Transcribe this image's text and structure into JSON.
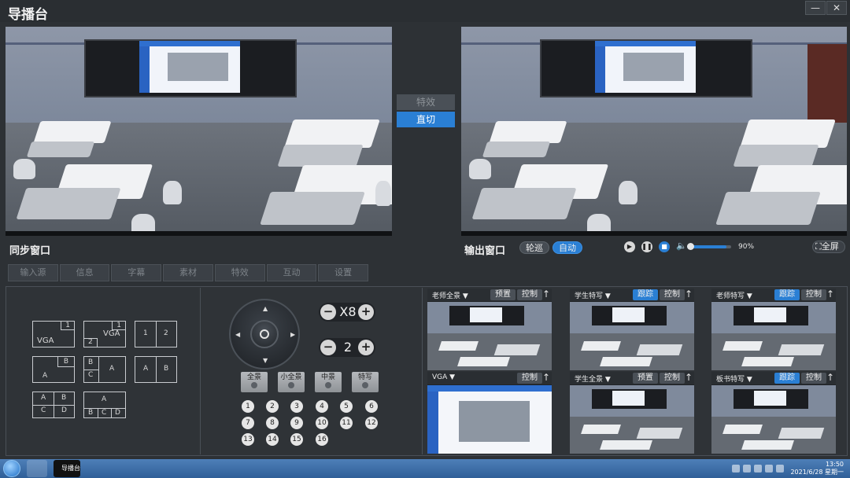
{
  "app": {
    "title": "导播台",
    "minimize": "—",
    "close": "✕"
  },
  "sync_window": {
    "label": "同步窗口"
  },
  "output_window": {
    "label": "输出窗口",
    "tour_label": "轮巡",
    "auto_label": "自动",
    "volume": "90%",
    "fullscreen_label": "全屏",
    "play_icon": "play-icon",
    "pause_icon": "pause-icon",
    "stop_icon": "stop-icon"
  },
  "transition": {
    "effects_label": "特效",
    "direct_cut_label": "直切"
  },
  "tabs": [
    "输入源",
    "信息",
    "字幕",
    "素材",
    "特效",
    "互动",
    "设置"
  ],
  "layouts": [
    {
      "labels": [
        "VGA",
        "1"
      ]
    },
    {
      "labels": [
        "VGA",
        "1",
        "2"
      ]
    },
    {
      "labels": [
        "1",
        "2"
      ]
    },
    {
      "labels": [
        "A",
        "B"
      ]
    },
    {
      "labels": [
        "B",
        "C",
        "A"
      ]
    },
    {
      "labels": [
        "A",
        "B"
      ]
    },
    {
      "labels": [
        "A",
        "B",
        "C",
        "D"
      ]
    },
    {
      "labels": [
        "A",
        "B",
        "C",
        "D"
      ]
    }
  ],
  "ptz": {
    "zoom_value": "X8",
    "speed_value": "2",
    "minus": "−",
    "plus": "+",
    "presets": [
      "全景",
      "小全景",
      "中景",
      "特写"
    ],
    "numbers": [
      "1",
      "2",
      "3",
      "4",
      "5",
      "6",
      "7",
      "8",
      "9",
      "10",
      "11",
      "12",
      "13",
      "14",
      "15",
      "16"
    ]
  },
  "cameras": [
    {
      "name": "老师全景",
      "tag1": "预置",
      "tag2": "控制",
      "tag1_active": false
    },
    {
      "name": "学生特写",
      "tag1": "跟踪",
      "tag2": "控制",
      "tag1_active": true
    },
    {
      "name": "老师特写",
      "tag1": "跟踪",
      "tag2": "控制",
      "tag1_active": true
    },
    {
      "name": "VGA",
      "tag1": "",
      "tag2": "控制",
      "tag1_active": false
    },
    {
      "name": "学生全景",
      "tag1": "预置",
      "tag2": "控制",
      "tag1_active": false
    },
    {
      "name": "板书特写",
      "tag1": "跟踪",
      "tag2": "控制",
      "tag1_active": true
    }
  ],
  "taskbar": {
    "app_label": "导播台",
    "time": "13:50",
    "date": "2021/6/28 星期一"
  },
  "colors": {
    "accent": "#2a7fd4",
    "background": "#2d3135"
  }
}
